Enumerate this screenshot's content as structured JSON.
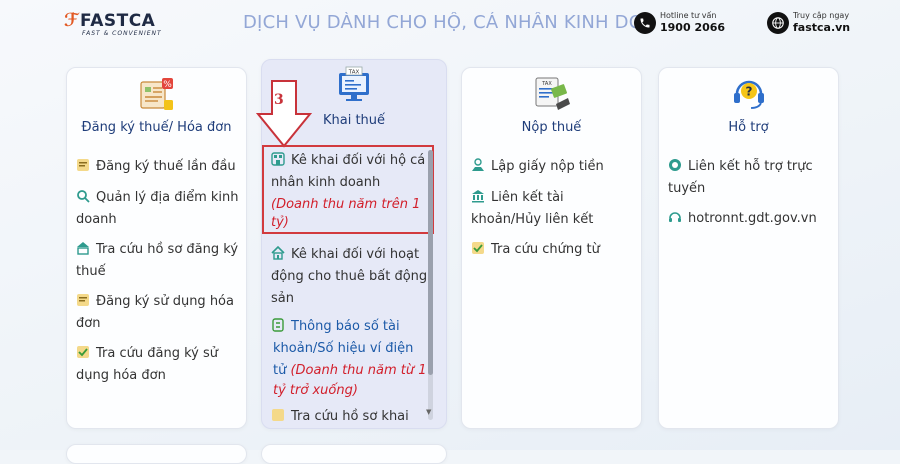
{
  "brand": {
    "name": "FASTCA",
    "tagline": "FAST & CONVENIENT"
  },
  "header": {
    "title": "DỊCH VỤ DÀNH CHO HỘ, CÁ NHÂN KINH DOANH"
  },
  "hotline": {
    "label": "Hotline tư vấn",
    "number": "1900 2066"
  },
  "access": {
    "label": "Truy cập ngay",
    "site": "fastca.vn"
  },
  "annotation": {
    "step": "3"
  },
  "cards": {
    "register": {
      "title": "Đăng ký thuế/ Hóa đơn",
      "items": [
        "Đăng ký thuế lần đầu",
        "Quản lý địa điểm kinh",
        "doanh",
        "Tra cứu hồ sơ đăng ký",
        "thuế",
        "Đăng ký sử dụng hóa",
        "đơn",
        "Tra cứu đăng ký sử",
        "dụng hóa đơn"
      ]
    },
    "declare": {
      "title": "Khai thuế",
      "items": {
        "i1_a": "Kê khai đối với hộ cá",
        "i1_b": "nhân kinh doanh",
        "i1_c": "(Doanh thu năm trên 1",
        "i1_d": "tỷ)",
        "i2_a": "Kê khai đối với hoạt",
        "i2_b": "động cho thuê bất động",
        "i2_c": "sản",
        "i3_a": "Thông báo số tài",
        "i3_b": "khoản/Số hiệu ví điện",
        "i3_c": "tử ",
        "i3_c_red": "(Doanh thu năm từ 1",
        "i3_d": "tỷ trở xuống)",
        "i4": "Tra cứu hồ sơ khai"
      }
    },
    "pay": {
      "title": "Nộp thuế",
      "items": [
        "Lập giấy nộp tiền",
        "Liên kết tài",
        "khoản/Hủy liên kết",
        "Tra cứu chứng từ"
      ]
    },
    "support": {
      "title": "Hỗ trợ",
      "items": [
        "Liên kết hỗ trợ trực",
        "tuyến",
        "hotronnt.gdt.gov.vn"
      ]
    }
  }
}
